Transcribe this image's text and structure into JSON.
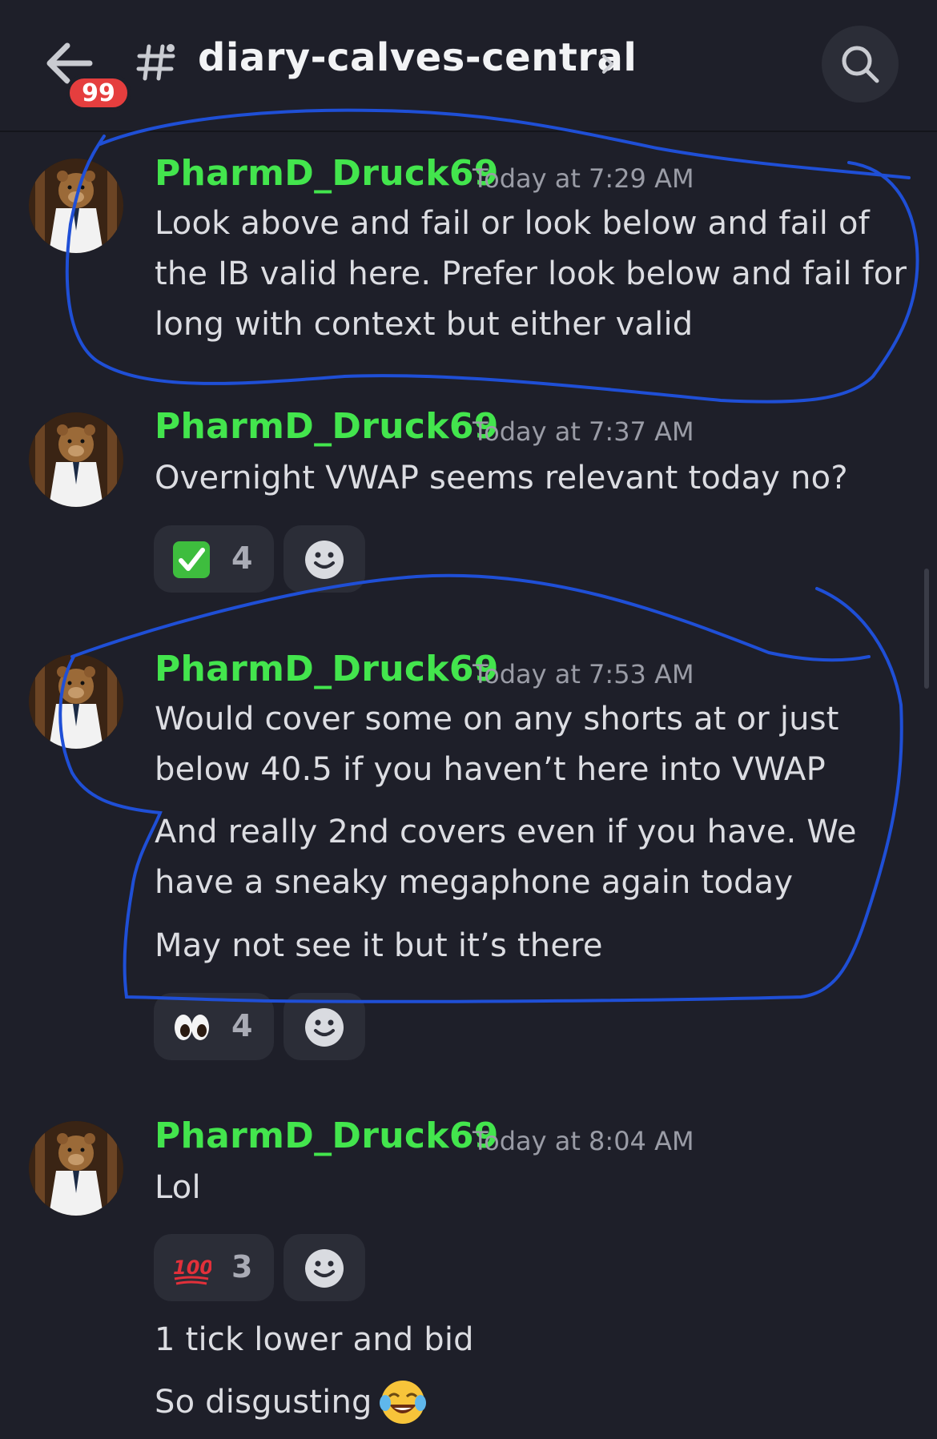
{
  "header": {
    "unread_badge": "99",
    "channel_name": "diary-calves-central",
    "icons": {
      "back": "arrow-left-icon",
      "channel": "hashtag-icon",
      "chevron": "chevron-right-icon",
      "search": "search-icon"
    }
  },
  "messages": [
    {
      "author": "PharmD_Druck69",
      "time": "Today at 7:29 AM",
      "lines": [
        "Look above and fail or look below and fail of",
        "the IB valid here. Prefer look below and fail for",
        "long with context but either valid"
      ]
    },
    {
      "author": "PharmD_Druck69",
      "time": "Today at 7:37 AM",
      "lines": [
        "Overnight VWAP seems relevant today no?"
      ],
      "reactions": [
        {
          "emoji": "check-mark-button-emoji",
          "count": "4"
        }
      ]
    },
    {
      "author": "PharmD_Druck69",
      "time": "Today at 7:53 AM",
      "lines": [
        "Would cover some on any shorts at or just",
        "below 40.5 if you haven’t here into VWAP",
        "And really 2nd covers even if you have. We",
        "have a sneaky megaphone again today",
        "May not see it but it’s there"
      ],
      "reactions": [
        {
          "emoji": "eyes-emoji",
          "count": "4"
        }
      ]
    },
    {
      "author": "PharmD_Druck69",
      "time": "Today at 8:04 AM",
      "lines": [
        "Lol",
        "1 tick lower and bid",
        "So disgusting"
      ],
      "reactions": [
        {
          "emoji": "hundred-points-emoji",
          "count": "3"
        }
      ]
    }
  ],
  "colors": {
    "background": "#1e1f29",
    "username": "#43e54d",
    "annotation": "#1f4fd6",
    "badge": "#e53e3e"
  }
}
